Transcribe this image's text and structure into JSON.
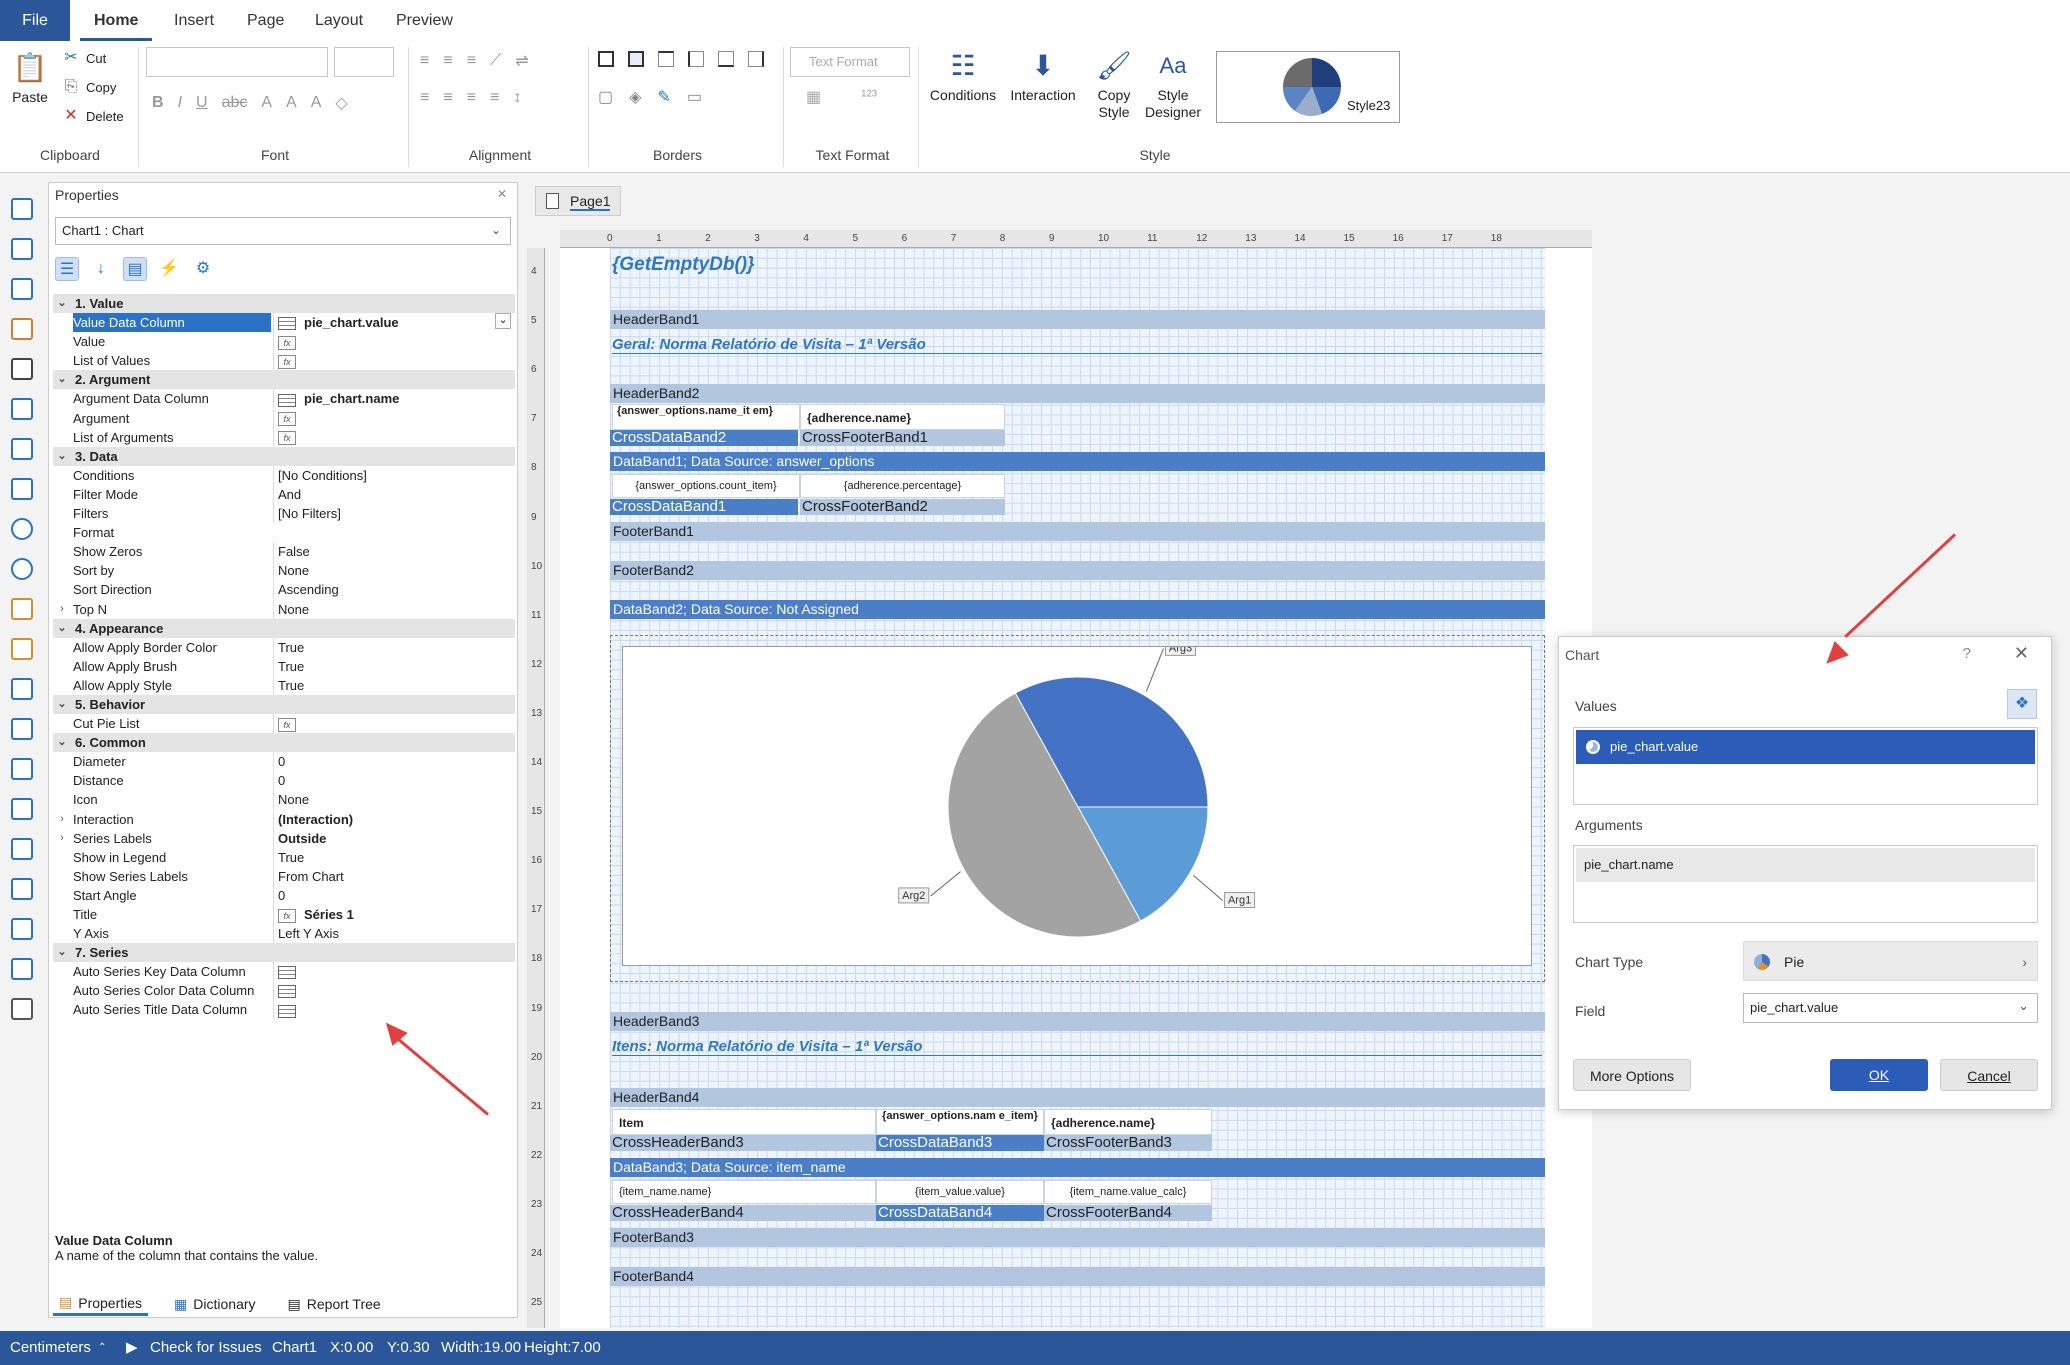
{
  "menu": {
    "file": "File",
    "home": "Home",
    "insert": "Insert",
    "page": "Page",
    "layout": "Layout",
    "preview": "Preview"
  },
  "ribbon": {
    "clipboard": {
      "paste": "Paste",
      "cut": "Cut",
      "copy": "Copy",
      "delete": "Delete",
      "group": "Clipboard"
    },
    "font_group": "Font",
    "alignment_group": "Alignment",
    "borders_group": "Borders",
    "textformat": {
      "field": "Text Format",
      "group": "Text Format"
    },
    "style": {
      "conditions": "Conditions",
      "interaction": "Interaction",
      "copy_style_1": "Copy",
      "copy_style_2": "Style",
      "designer_1": "Style",
      "designer_2": "Designer",
      "preview_name": "Style23",
      "group": "Style"
    }
  },
  "properties": {
    "title": "Properties",
    "object": "Chart1 : Chart",
    "rows": [
      {
        "t": "cat",
        "name": "1. Value",
        "exp": "⌄"
      },
      {
        "t": "col",
        "name": "Value Data Column",
        "value": "pie_chart.value",
        "bold": true,
        "sel": true
      },
      {
        "t": "fx",
        "name": "Value",
        "value": ""
      },
      {
        "t": "fx",
        "name": "List of Values",
        "value": ""
      },
      {
        "t": "cat",
        "name": "2. Argument",
        "exp": "⌄"
      },
      {
        "t": "col",
        "name": "Argument Data Column",
        "value": "pie_chart.name",
        "bold": true
      },
      {
        "t": "fx",
        "name": "Argument",
        "value": ""
      },
      {
        "t": "fx",
        "name": "List of Arguments",
        "value": ""
      },
      {
        "t": "cat",
        "name": "3. Data",
        "exp": "⌄"
      },
      {
        "t": "txt",
        "name": "Conditions",
        "value": "[No Conditions]"
      },
      {
        "t": "txt",
        "name": "Filter Mode",
        "value": "And"
      },
      {
        "t": "txt",
        "name": "Filters",
        "value": "[No Filters]"
      },
      {
        "t": "txt",
        "name": "Format",
        "value": ""
      },
      {
        "t": "txt",
        "name": "Show Zeros",
        "value": "False"
      },
      {
        "t": "txt",
        "name": "Sort by",
        "value": "None"
      },
      {
        "t": "txt",
        "name": "Sort Direction",
        "value": "Ascending"
      },
      {
        "t": "txt",
        "name": "Top N",
        "value": "None",
        "exp": "›"
      },
      {
        "t": "cat",
        "name": "4. Appearance",
        "exp": "⌄"
      },
      {
        "t": "txt",
        "name": "Allow Apply Border Color",
        "value": "True"
      },
      {
        "t": "txt",
        "name": "Allow Apply Brush",
        "value": "True"
      },
      {
        "t": "txt",
        "name": "Allow Apply Style",
        "value": "True"
      },
      {
        "t": "cat",
        "name": "5. Behavior",
        "exp": "⌄"
      },
      {
        "t": "fx",
        "name": "Cut Pie List",
        "value": ""
      },
      {
        "t": "cat",
        "name": "6. Common",
        "exp": "⌄"
      },
      {
        "t": "txt",
        "name": "Diameter",
        "value": "0"
      },
      {
        "t": "txt",
        "name": "Distance",
        "value": "0"
      },
      {
        "t": "txt",
        "name": "Icon",
        "value": "None"
      },
      {
        "t": "txt",
        "name": "Interaction",
        "value": "(Interaction)",
        "bold": true,
        "exp": "›"
      },
      {
        "t": "txt",
        "name": "Series Labels",
        "value": "Outside",
        "bold": true,
        "exp": "›"
      },
      {
        "t": "txt",
        "name": "Show in Legend",
        "value": "True"
      },
      {
        "t": "txt",
        "name": "Show Series Labels",
        "value": "From Chart"
      },
      {
        "t": "txt",
        "name": "Start Angle",
        "value": "0"
      },
      {
        "t": "fx",
        "name": "Title",
        "value": "Séries 1",
        "bold": true
      },
      {
        "t": "txt",
        "name": "Y Axis",
        "value": "Left Y Axis"
      },
      {
        "t": "cat",
        "name": "7. Series",
        "exp": "⌄"
      },
      {
        "t": "col",
        "name": "Auto Series Key Data Column",
        "value": ""
      },
      {
        "t": "col",
        "name": "Auto Series Color Data Column",
        "value": ""
      },
      {
        "t": "col",
        "name": "Auto Series Title Data Column",
        "value": ""
      }
    ],
    "desc_title": "Value Data Column",
    "desc_text": "A name of the column that contains the value.",
    "tabs": [
      "Properties",
      "Dictionary",
      "Report Tree"
    ]
  },
  "page_tab": "Page1",
  "ruler_h": [
    "0",
    "1",
    "2",
    "3",
    "4",
    "5",
    "6",
    "7",
    "8",
    "9",
    "10",
    "11",
    "12",
    "13",
    "14",
    "15",
    "16",
    "17",
    "18"
  ],
  "ruler_v": [
    "4",
    "5",
    "6",
    "7",
    "8",
    "9",
    "10",
    "11",
    "12",
    "13",
    "14",
    "15",
    "16",
    "17",
    "18",
    "19",
    "20",
    "21",
    "22",
    "23",
    "24",
    "25"
  ],
  "report": {
    "title0": "{GetEmptyDb()}",
    "hb1": "HeaderBand1",
    "title1": "Geral: Norma Relatório de Visita – 1ª Versão",
    "hb2": "HeaderBand2",
    "cell_optname": "{answer_options.name_it em}",
    "cell_adhname": "{adherence.name}",
    "cdb2": "CrossDataBand2",
    "cfb1": "CrossFooterBand1",
    "db1": "DataBand1; Data Source: answer_options",
    "cell_count": "{answer_options.count_item}",
    "cell_pct": "{adherence.percentage}",
    "cdb1": "CrossDataBand1",
    "cfb2": "CrossFooterBand2",
    "fb1": "FooterBand1",
    "fb2": "FooterBand2",
    "db2": "DataBand2; Data Source: Not Assigned",
    "hb3": "HeaderBand3",
    "title2": "Itens: Norma Relatório de Visita – 1ª Versão",
    "hb4": "HeaderBand4",
    "cell_item": "Item",
    "cell_optname2": "{answer_options.nam e_item}",
    "cell_adhname2": "{adherence.name}",
    "chb3": "CrossHeaderBand3",
    "cdb3": "CrossDataBand3",
    "cfb3": "CrossFooterBand3",
    "db3": "DataBand3; Data Source: item_name",
    "cell_itemname": "{item_name.name}",
    "cell_itemvalue": "{item_value.value}",
    "cell_itemcalc": "{item_name.value_calc}",
    "chb4": "CrossHeaderBand4",
    "cdb4": "CrossDataBand4",
    "cfb4": "CrossFooterBand4",
    "fb3": "FooterBand3",
    "fb4": "FooterBand4"
  },
  "pie": {
    "labels": [
      "Arg1",
      "Arg2",
      "Arg3"
    ],
    "values": [
      17,
      50,
      33
    ],
    "colors": [
      "#5a9bd8",
      "#a3a3a3",
      "#4472c4"
    ]
  },
  "dialog": {
    "title": "Chart",
    "help": "?",
    "values_label": "Values",
    "values_item": "pie_chart.value",
    "arguments_label": "Arguments",
    "arguments_item": "pie_chart.name",
    "chart_type_label": "Chart Type",
    "chart_type": "Pie",
    "field_label": "Field",
    "field_value": "pie_chart.value",
    "more_options": "More Options",
    "ok": "OK",
    "cancel": "Cancel"
  },
  "status": {
    "units": "Centimeters",
    "check": "Check for Issues",
    "object": "Chart1",
    "x": "X:0.00",
    "y": "Y:0.30",
    "w": "Width:19.00",
    "h": "Height:7.00"
  }
}
